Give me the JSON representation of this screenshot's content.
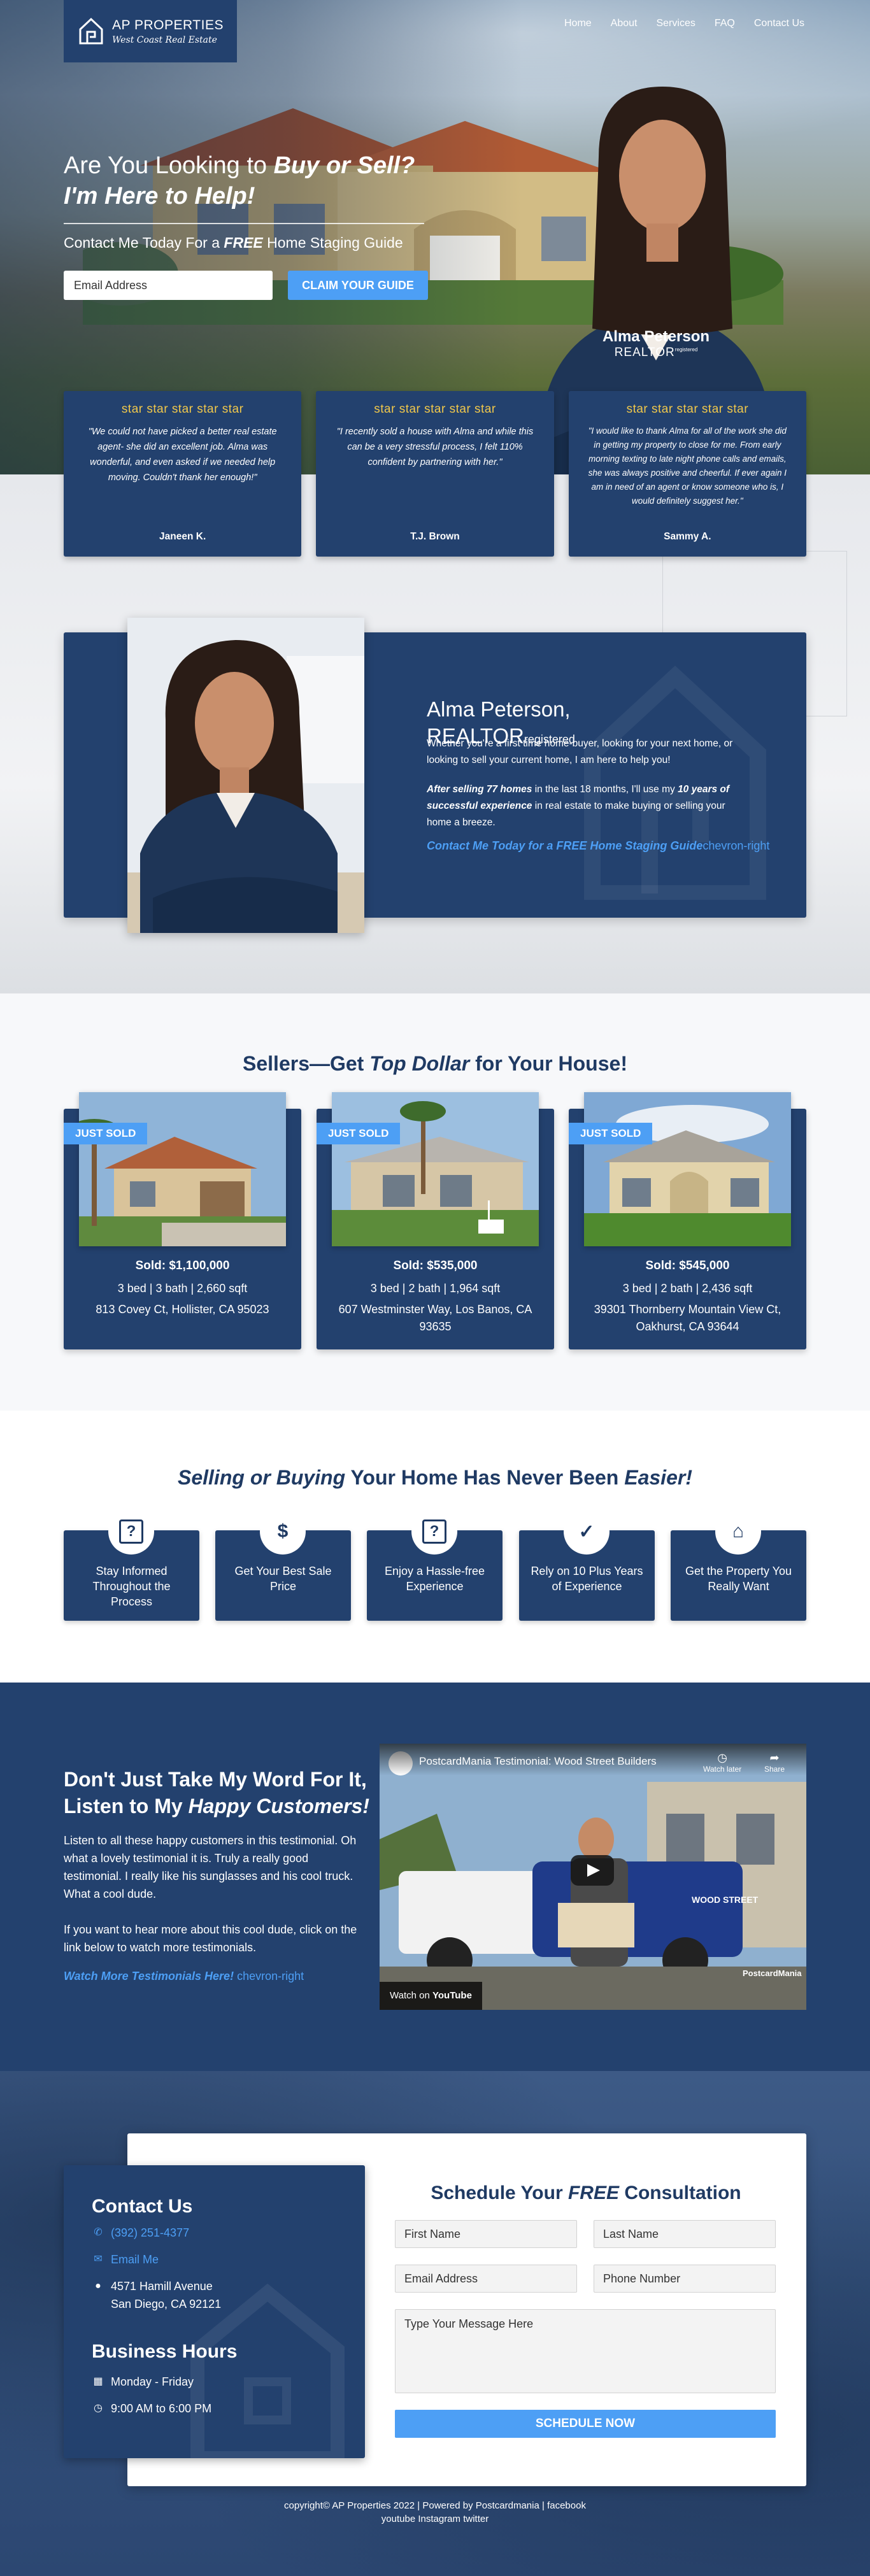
{
  "header": {
    "logo_title": "AP PROPERTIES",
    "logo_sub": "West Coast Real Estate",
    "nav": [
      "Home",
      "About",
      "Services",
      "FAQ",
      "Contact Us"
    ]
  },
  "hero": {
    "headline_pre": "Are You Looking to ",
    "headline_em": "Buy or Sell?",
    "headline_line2": "I'm Here to Help!",
    "sub_pre": "Contact Me Today For a ",
    "sub_em": "FREE",
    "sub_post": " Home Staging Guide",
    "email_placeholder": "Email Address",
    "cta_label": "CLAIM YOUR GUIDE",
    "agent_name": "Alma Peterson",
    "agent_title": "REALTOR",
    "agent_title_mark": "registered"
  },
  "testimonials": [
    {
      "stars": "star star star star star",
      "quote": "\"We could not have picked a better real estate agent- she did an excellent job. Alma was wonderful, and even asked if we needed help moving. Couldn't thank her enough!\"",
      "author": "Janeen K."
    },
    {
      "stars": "star star star star star",
      "quote": "\"I recently sold a house with Alma and while this can be a very stressful process, I felt 110% confident by partnering with her.\"",
      "author": "T.J. Brown"
    },
    {
      "stars": "star star star star star",
      "quote": "\"I would like to thank Alma for all of the work she did in getting my property to close for me. From early morning texting to late night phone calls and emails, she was always positive and cheerful. If ever again I am in need of an agent or know someone who is, I would definitely suggest her.\"",
      "author": "Sammy A."
    }
  ],
  "about": {
    "name": "Alma Peterson,",
    "title": "REALTOR",
    "title_mark": "registered",
    "p1": "Whether you're a first time home-buyer, looking for your next home, or looking to sell your current home, I am here to help you!",
    "p2_em": "After selling 77 homes",
    "p2_mid": " in the last 18 months, I'll use my ",
    "p2_em2": "10 years of successful experience",
    "p2_post": " in real estate to make buying or selling your home a breeze.",
    "link_label": "Contact Me Today for a FREE Home Staging Guide",
    "link_icon": "chevron-right"
  },
  "sold": {
    "title_pre": "Sellers—Get ",
    "title_em": "Top Dollar",
    "title_post": " for Your House!",
    "badge": "JUST SOLD",
    "listings": [
      {
        "price": "Sold: $1,100,000",
        "details": "3 bed | 3 bath | 2,660 sqft",
        "address": "813 Covey Ct, Hollister, CA 95023"
      },
      {
        "price": "Sold: $535,000",
        "details": "3 bed | 2 bath | 1,964 sqft",
        "address": "607 Westminster Way, Los Banos, CA 93635"
      },
      {
        "price": "Sold: $545,000",
        "details": "3 bed | 2 bath | 2,436 sqft",
        "address": "39301 Thornberry Mountain View Ct, Oakhurst, CA 93644"
      }
    ]
  },
  "features": {
    "title_em1": "Selling or Buying",
    "title_mid": " Your Home Has Never Been ",
    "title_em2": "Easier!",
    "items": [
      {
        "icon": "question-box",
        "label": "Stay Informed Throughout the Process"
      },
      {
        "icon": "money-wave",
        "label": "Get Your Best Sale Price"
      },
      {
        "icon": "question-box",
        "label": "Enjoy a Hassle-free Experience"
      },
      {
        "icon": "badge-check",
        "label": "Rely on 10 Plus Years of Experience"
      },
      {
        "icon": "home-heart",
        "label": "Get the Property You Really Want"
      }
    ]
  },
  "video_section": {
    "heading_line1": "Don't Just Take My Word For It,",
    "heading_pre2": "Listen to My ",
    "heading_em": "Happy Customers!",
    "p1": "Listen to all these happy customers in this testimonial. Oh what a lovely testimonial it is. Truly a really good testimonial. I really like his sunglasses and his cool truck. What a cool dude.",
    "p2": "If you want to hear more about this cool dude, click on the link below to watch more testimonials.",
    "link_label": "Watch More Testimonials Here!",
    "link_icon": "chevron-right",
    "video_title": "PostcardMania Testimonial: Wood Street Builders",
    "watch_later": "Watch later",
    "share": "Share",
    "watch_on": "Watch on",
    "youtube": "YouTube",
    "truck_text": "WOOD STREET",
    "brand": "PostcardMania"
  },
  "contact": {
    "heading": "Contact Us",
    "phone": "(392) 251-4377",
    "email": "Email Me",
    "address_line1": "4571 Hamill Avenue",
    "address_line2": "San Diego, CA 92121",
    "hours_heading": "Business Hours",
    "days": "Monday - Friday",
    "hours": "9:00 AM to 6:00 PM",
    "form_title_pre": "Schedule Your ",
    "form_title_em": "FREE",
    "form_title_post": " Consultation",
    "first_name": "First Name",
    "last_name": "Last Name",
    "email_field": "Email Address",
    "phone_field": "Phone Number",
    "message": "Type Your Message Here",
    "submit": "SCHEDULE NOW"
  },
  "footer": {
    "copyright": "copyright© AP Properties 2022",
    "powered": "Powered by Postcardmania",
    "facebook": "facebook",
    "social_line": "youtube Instagram twitter",
    "separator": "|"
  },
  "colors": {
    "navy": "#23416e",
    "accent_blue": "#4d9ff5",
    "star_gold": "#f1c84b",
    "heading_navy": "#1f3a63"
  }
}
